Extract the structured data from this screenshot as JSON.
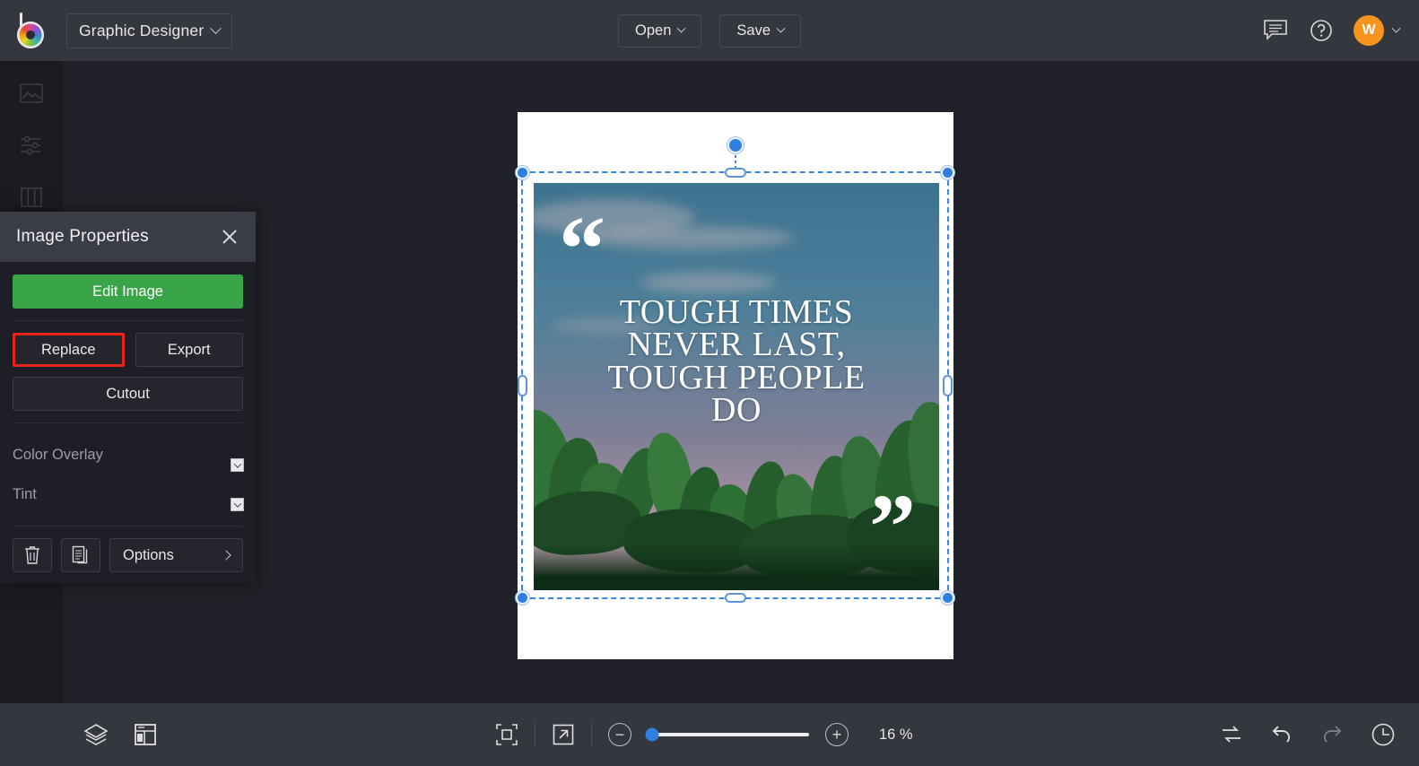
{
  "app": {
    "logo_icon": "bannersnack-color-wheel-logo",
    "document_title": "Graphic Designer"
  },
  "header": {
    "open_label": "Open",
    "save_label": "Save",
    "comments_icon": "comment-bubble-icon",
    "help_icon": "question-mark-circle-icon",
    "avatar_initial": "W",
    "avatar_color": "#f7941e"
  },
  "left_rail": {
    "items": [
      {
        "icon": "image-icon",
        "name": "sidebar-item-image"
      },
      {
        "icon": "sliders-icon",
        "name": "sidebar-item-adjustments"
      },
      {
        "icon": "columns-icon",
        "name": "sidebar-item-layout"
      }
    ]
  },
  "panel": {
    "title": "Image Properties",
    "close_icon": "close-icon",
    "edit_image_label": "Edit Image",
    "replace_label": "Replace",
    "export_label": "Export",
    "cutout_label": "Cutout",
    "color_overlay_label": "Color Overlay",
    "color_overlay_value": "#1c0806",
    "tint_label": "Tint",
    "tint_value": "#ffffff",
    "delete_icon": "trash-icon",
    "duplicate_icon": "copy-icon",
    "options_label": "Options",
    "options_chevron_icon": "chevron-right-icon",
    "highlight_color": "#e8241a",
    "primary_color": "#3aa548"
  },
  "canvas": {
    "artwork": {
      "quote_open_mark": "“",
      "quote_close_mark": "”",
      "lines": [
        "TOUGH TIMES",
        "NEVER LAST,",
        "TOUGH PEOPLE",
        "DO"
      ]
    },
    "selection": {
      "color": "#3b86e0",
      "rotate_handle_icon": "rotate-handle-icon"
    }
  },
  "bottombar": {
    "layers_icon": "layers-icon",
    "grid_icon": "page-layout-icon",
    "fit_icon": "fit-to-screen-icon",
    "fullscreen_icon": "expand-arrow-icon",
    "zoom_out_icon": "minus-circle-icon",
    "zoom_in_icon": "plus-circle-icon",
    "zoom_level": "16 %",
    "zoom_slider_position_pct": 3,
    "swap_icon": "swap-arrows-icon",
    "undo_icon": "undo-arrow-icon",
    "redo_icon": "redo-arrow-icon",
    "history_icon": "clock-history-icon"
  }
}
